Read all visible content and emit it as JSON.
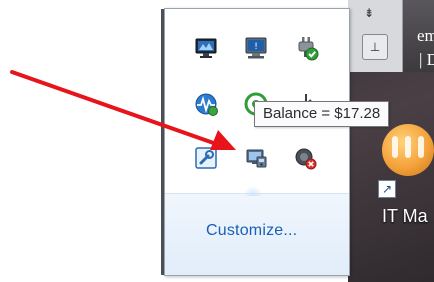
{
  "tray": {
    "tooltip": "Balance = $17.28",
    "customize_label": "Customize...",
    "icons": [
      {
        "name": "network-display-icon"
      },
      {
        "name": "monitor-info-icon"
      },
      {
        "name": "power-plug-check-icon"
      },
      {
        "name": "network-activity-icon"
      },
      {
        "name": "green-circle-icon"
      },
      {
        "name": "usb-icon"
      },
      {
        "name": "wrench-settings-icon"
      },
      {
        "name": "balance-app-icon"
      },
      {
        "name": "speaker-error-icon"
      }
    ]
  },
  "desktop": {
    "doc_text_1": "em",
    "doc_text_2": "| Dec",
    "app_label": "IT Ma",
    "scroll_up": "⇟",
    "scroll_btn": "⊥"
  },
  "colors": {
    "annotation_arrow": "#e8141c",
    "link": "#1a5fb4",
    "tray_border": "#9aa3ad"
  }
}
